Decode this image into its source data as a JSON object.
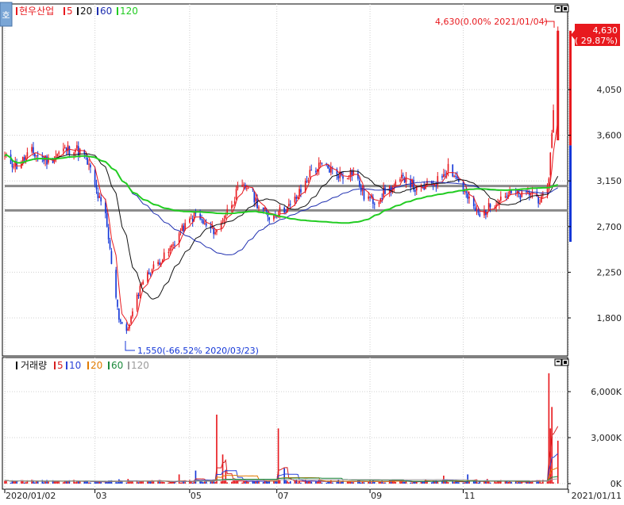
{
  "colors": {
    "up": "#e8191e",
    "down": "#1437d8",
    "ma5": "#e8191e",
    "ma20": "#111111",
    "ma60": "#1f2fb0",
    "ma120": "#22cc22",
    "vol5": "#d62020",
    "vol10": "#2b45d8",
    "vol20": "#e07b00",
    "vol60": "#1c8a3c",
    "vol120": "#9a9a9a",
    "hline": "#8a8a8a",
    "axis": "#000000",
    "grid": "#d0d0d0",
    "price_tag": "#e8191e"
  },
  "header": {
    "corner_icon_label": "호",
    "price_legend": {
      "name": "현우산업",
      "ma_items": [
        "5",
        "20",
        "60",
        "120"
      ]
    },
    "volume_legend": {
      "name": "거래량",
      "ma_items": [
        "5",
        "10",
        "20",
        "60",
        "120"
      ]
    }
  },
  "annotations": {
    "high_label": "4,630(0.00% 2021/01/04)",
    "low_label": "1,550(-66.52% 2020/03/23)",
    "current_price": "4,630",
    "current_change": "( 29.87%)"
  },
  "chart_data": [
    {
      "type": "candlestick",
      "title": "현우산업",
      "y_axis_ticks": [
        "4,050",
        "3,600",
        "3,150",
        "2,700",
        "2,250",
        "1,800"
      ],
      "y_tick_values": [
        4050,
        3600,
        3150,
        2700,
        2250,
        1800
      ],
      "ylim": [
        1500,
        4650
      ],
      "x_tick_labels": [
        "2020/01/02",
        "03",
        "05",
        "07",
        "09",
        "11",
        "2021/01/11"
      ],
      "x_tick_dates": [
        "2020-01-02",
        "2020-03-02",
        "2020-05-04",
        "2020-07-01",
        "2020-09-01",
        "2020-11-02",
        "2021-01-11"
      ],
      "xlim": [
        "2020-01-02",
        "2021-01-11"
      ],
      "horizontal_lines": [
        3100,
        2860
      ],
      "moving_averages": [
        "5",
        "20",
        "60",
        "120"
      ],
      "price_path": [
        [
          "2020-01-02",
          3380
        ],
        [
          "2020-01-10",
          3300
        ],
        [
          "2020-01-20",
          3430
        ],
        [
          "2020-01-31",
          3350
        ],
        [
          "2020-02-10",
          3450
        ],
        [
          "2020-02-17",
          3480
        ],
        [
          "2020-02-24",
          3400
        ],
        [
          "2020-02-28",
          3250
        ],
        [
          "2020-03-04",
          3000
        ],
        [
          "2020-03-09",
          2800
        ],
        [
          "2020-03-13",
          2350
        ],
        [
          "2020-03-18",
          1800
        ],
        [
          "2020-03-23",
          1650
        ],
        [
          "2020-03-27",
          1850
        ],
        [
          "2020-04-02",
          2150
        ],
        [
          "2020-04-10",
          2300
        ],
        [
          "2020-04-20",
          2450
        ],
        [
          "2020-04-28",
          2650
        ],
        [
          "2020-05-08",
          2820
        ],
        [
          "2020-05-15",
          2700
        ],
        [
          "2020-05-22",
          2650
        ],
        [
          "2020-05-29",
          2850
        ],
        [
          "2020-06-05",
          3050
        ],
        [
          "2020-06-12",
          3100
        ],
        [
          "2020-06-19",
          2900
        ],
        [
          "2020-06-26",
          2800
        ],
        [
          "2020-07-03",
          2850
        ],
        [
          "2020-07-10",
          2900
        ],
        [
          "2020-07-17",
          3050
        ],
        [
          "2020-07-24",
          3250
        ],
        [
          "2020-07-31",
          3300
        ],
        [
          "2020-08-07",
          3250
        ],
        [
          "2020-08-14",
          3200
        ],
        [
          "2020-08-21",
          3250
        ],
        [
          "2020-08-28",
          3000
        ],
        [
          "2020-09-04",
          2950
        ],
        [
          "2020-09-11",
          3050
        ],
        [
          "2020-09-18",
          3100
        ],
        [
          "2020-09-25",
          3200
        ],
        [
          "2020-10-02",
          3050
        ],
        [
          "2020-10-09",
          3100
        ],
        [
          "2020-10-16",
          3150
        ],
        [
          "2020-10-23",
          3300
        ],
        [
          "2020-10-30",
          3150
        ],
        [
          "2020-11-06",
          2950
        ],
        [
          "2020-11-13",
          2800
        ],
        [
          "2020-11-20",
          2900
        ],
        [
          "2020-11-27",
          3000
        ],
        [
          "2020-12-04",
          3020
        ],
        [
          "2020-12-11",
          3000
        ],
        [
          "2020-12-18",
          3030
        ],
        [
          "2020-12-24",
          2950
        ],
        [
          "2020-12-28",
          3050
        ],
        [
          "2020-12-30",
          3400
        ],
        [
          "2021-01-04",
          4630
        ]
      ],
      "low": {
        "date": "2020-03-23",
        "value": 1550
      },
      "high": {
        "date": "2021-01-04",
        "value": 4630
      },
      "current": {
        "value": 4630,
        "change_pct": 29.87
      }
    },
    {
      "type": "bar",
      "title": "거래량",
      "y_axis_ticks": [
        "6,000K",
        "3,000K",
        "0K"
      ],
      "y_tick_values": [
        6000,
        3000,
        0
      ],
      "ylim": [
        0,
        7500
      ],
      "unit": "K",
      "moving_averages": [
        "5",
        "10",
        "20",
        "60",
        "120"
      ],
      "baseline_volume": 150,
      "spikes": [
        [
          "2020-01-20",
          250
        ],
        [
          "2020-03-18",
          280
        ],
        [
          "2020-03-24",
          300
        ],
        [
          "2020-04-27",
          600
        ],
        [
          "2020-05-08",
          850
        ],
        [
          "2020-05-22",
          4500
        ],
        [
          "2020-05-26",
          1900
        ],
        [
          "2020-05-28",
          900
        ],
        [
          "2020-07-02",
          3600
        ],
        [
          "2020-07-06",
          1000
        ],
        [
          "2020-09-16",
          260
        ],
        [
          "2020-10-20",
          520
        ],
        [
          "2020-11-05",
          600
        ],
        [
          "2020-11-18",
          300
        ],
        [
          "2020-12-29",
          7200
        ],
        [
          "2020-12-30",
          3600
        ],
        [
          "2020-12-31",
          5000
        ],
        [
          "2021-01-04",
          2800
        ],
        [
          "2021-01-05",
          1800
        ]
      ]
    }
  ]
}
